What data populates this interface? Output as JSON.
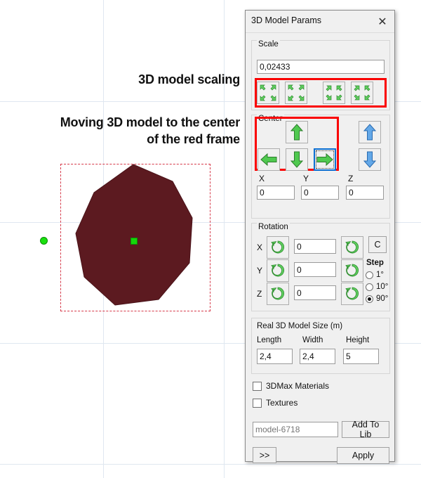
{
  "annotations": {
    "scaling": "3D model scaling",
    "centering_line1": "Moving 3D model to the center",
    "centering_line2": "of the red frame"
  },
  "dialog": {
    "title": "3D Model Params",
    "close_label": "✕",
    "scale": {
      "group_label": "Scale",
      "value": "0,02433",
      "buttons": [
        {
          "name": "scale-down-fast",
          "icon": "arrows-inward-icon"
        },
        {
          "name": "scale-down-slow",
          "icon": "arrows-inward-icon"
        },
        {
          "name": "scale-up-slow",
          "icon": "arrows-outward-icon"
        },
        {
          "name": "scale-up-fast",
          "icon": "arrows-outward-icon"
        }
      ]
    },
    "center": {
      "group_label": "Center",
      "buttons": [
        {
          "name": "move-up",
          "icon": "arrow-up-green-icon"
        },
        {
          "name": "move-left",
          "icon": "arrow-left-green-icon"
        },
        {
          "name": "move-down",
          "icon": "arrow-down-green-icon"
        },
        {
          "name": "move-right",
          "icon": "arrow-right-green-icon",
          "focused": true
        },
        {
          "name": "move-z-up",
          "icon": "arrow-up-blue-icon"
        },
        {
          "name": "move-z-down",
          "icon": "arrow-down-blue-icon"
        }
      ],
      "fields": [
        {
          "label": "X",
          "value": "0"
        },
        {
          "label": "Y",
          "value": "0"
        },
        {
          "label": "Z",
          "value": "0"
        }
      ]
    },
    "rotation": {
      "group_label": "Rotation",
      "axes": [
        {
          "label": "X",
          "value": "0"
        },
        {
          "label": "Y",
          "value": "0"
        },
        {
          "label": "Z",
          "value": "0"
        }
      ],
      "reset_label": "C",
      "step_label": "Step",
      "step_options": [
        {
          "label": "1°",
          "selected": false
        },
        {
          "label": "10°",
          "selected": false
        },
        {
          "label": "90°",
          "selected": true
        }
      ]
    },
    "size": {
      "group_label": "Real 3D Model Size (m)",
      "fields": [
        {
          "label": "Length",
          "value": "2,4"
        },
        {
          "label": "Width",
          "value": "2,4"
        },
        {
          "label": "Height",
          "value": "5"
        }
      ]
    },
    "checkboxes": [
      {
        "label": "3DMax Materials",
        "checked": false
      },
      {
        "label": "Textures",
        "checked": false
      }
    ],
    "model_name_placeholder": "model-6718",
    "add_to_lib_label": "Add To Lib",
    "expand_label": ">>",
    "apply_label": "Apply"
  },
  "viewport": {
    "model_fill": "#5c1a20",
    "frame_color": "#d63a4a",
    "center_marker_color": "#16d60a",
    "grid_color": "#dfe7f0"
  }
}
